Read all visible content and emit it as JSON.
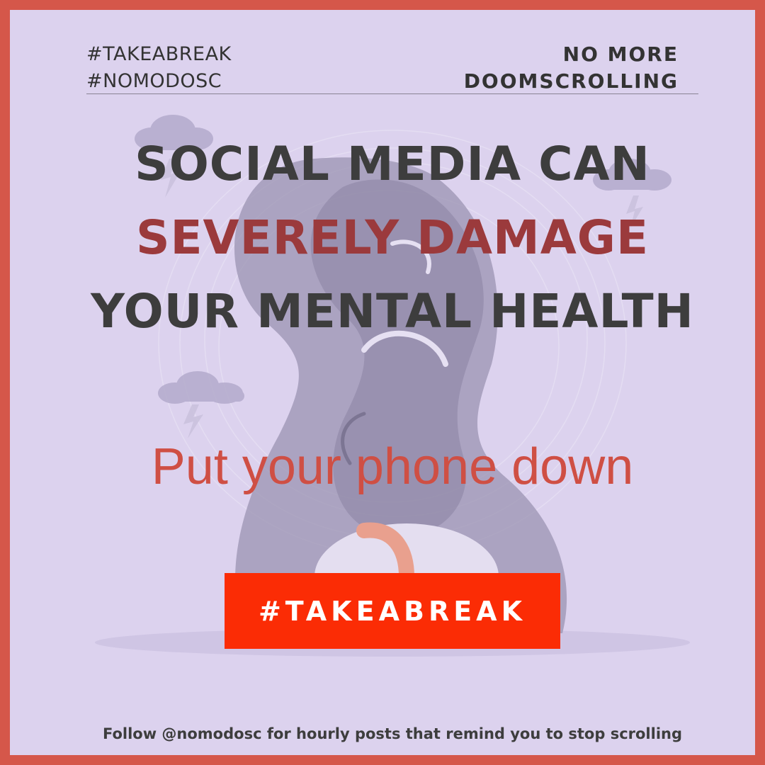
{
  "header": {
    "hashtags": [
      "#TAKEABREAK",
      "#NOMODOSC"
    ],
    "tagline": [
      "NO MORE",
      "DOOMSCROLLING"
    ]
  },
  "headline": {
    "line1": "SOCIAL MEDIA CAN",
    "line2": "SEVERELY DAMAGE",
    "line3": "YOUR MENTAL HEALTH"
  },
  "cta": {
    "text": "Put your phone down",
    "button_label": "#TAKEABREAK"
  },
  "footer": {
    "text": "Follow @nomodosc for hourly posts that remind you to stop scrolling"
  },
  "illustration": {
    "icon": "stressed-person-scribble-head-illustration",
    "cloud_icon": "storm-cloud-icon"
  },
  "colors": {
    "frame": "#d5574a",
    "background": "#dcd2ee",
    "accent_red": "#9b3a3c",
    "cta_text": "#cf4f44",
    "button": "#fb2c05",
    "text_dark": "#3d3d3d"
  }
}
